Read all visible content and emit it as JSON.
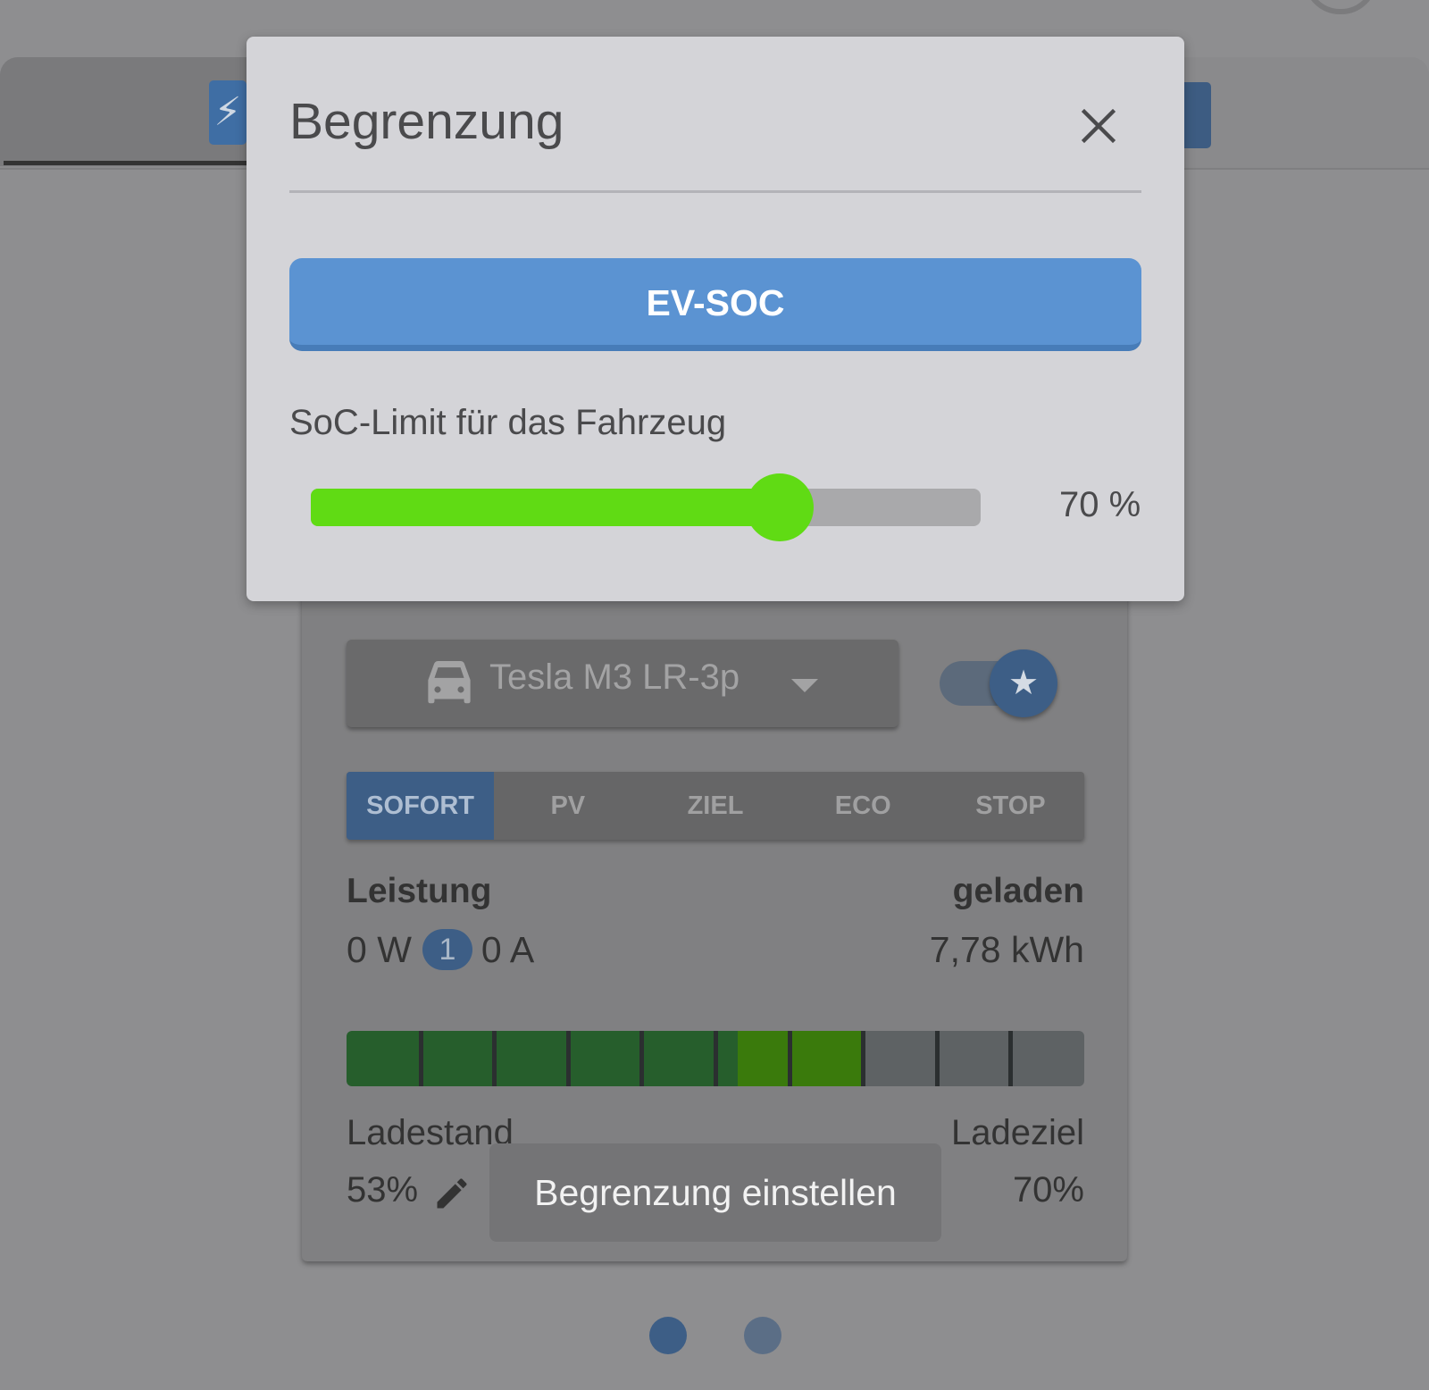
{
  "modal": {
    "title": "Begrenzung",
    "limit_mode_button": "EV-SOC",
    "soc_limit_label": "SoC-Limit für das Fahrzeug",
    "soc_limit_value": "70 %",
    "soc_limit_fraction": 0.7,
    "slider_color": "#60db14",
    "button_color": "#5b93d2"
  },
  "vehicle": {
    "name": "Tesla M3 LR-3p",
    "icon": "car-icon"
  },
  "modes": {
    "items": [
      "SOFORT",
      "PV",
      "ZIEL",
      "ECO",
      "STOP"
    ],
    "active": "SOFORT"
  },
  "stats": {
    "power_label": "Leistung",
    "power_value": "0 W",
    "phases": "1",
    "current_value": "0 A",
    "charged_label": "geladen",
    "charged_value": "7,78 kWh"
  },
  "soc": {
    "current_fraction": 0.53,
    "target_fraction": 0.7,
    "state_label": "Ladestand",
    "state_value": "53%",
    "target_label": "Ladeziel",
    "target_value": "70%"
  },
  "tooltip": {
    "text": "Begrenzung einstellen"
  },
  "pager": {
    "count": 2,
    "active": 0
  }
}
